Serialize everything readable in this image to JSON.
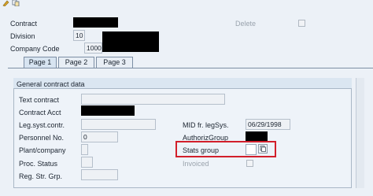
{
  "header": {
    "contract_label": "Contract",
    "division_label": "Division",
    "division_value": "10",
    "company_code_label": "Company Code",
    "company_code_value": "1000",
    "delete_label": "Delete"
  },
  "tabs": [
    {
      "label": "Page 1",
      "active": true
    },
    {
      "label": "Page 2",
      "active": false
    },
    {
      "label": "Page 3",
      "active": false
    }
  ],
  "panel": {
    "title": "General contract data",
    "fields": {
      "text_contract_label": "Text contract",
      "contract_acct_label": "Contract Acct",
      "leg_syst_contr_label": "Leg.syst.contr.",
      "personnel_no_label": "Personnel No.",
      "personnel_no_value": "0",
      "plant_company_label": "Plant/company",
      "proc_status_label": "Proc. Status",
      "reg_str_grp_label": "Reg. Str. Grp.",
      "mid_fr_legsys_label": "MID fr. legSys.",
      "mid_fr_legsys_value": "06/29/1998",
      "authoriz_group_label": "AuthorizGroup",
      "stats_group_label": "Stats group",
      "invoiced_label": "Invoiced"
    }
  },
  "colors": {
    "highlight": "#d21f2b",
    "background": "#ecf1f7",
    "redaction": "#000000"
  }
}
